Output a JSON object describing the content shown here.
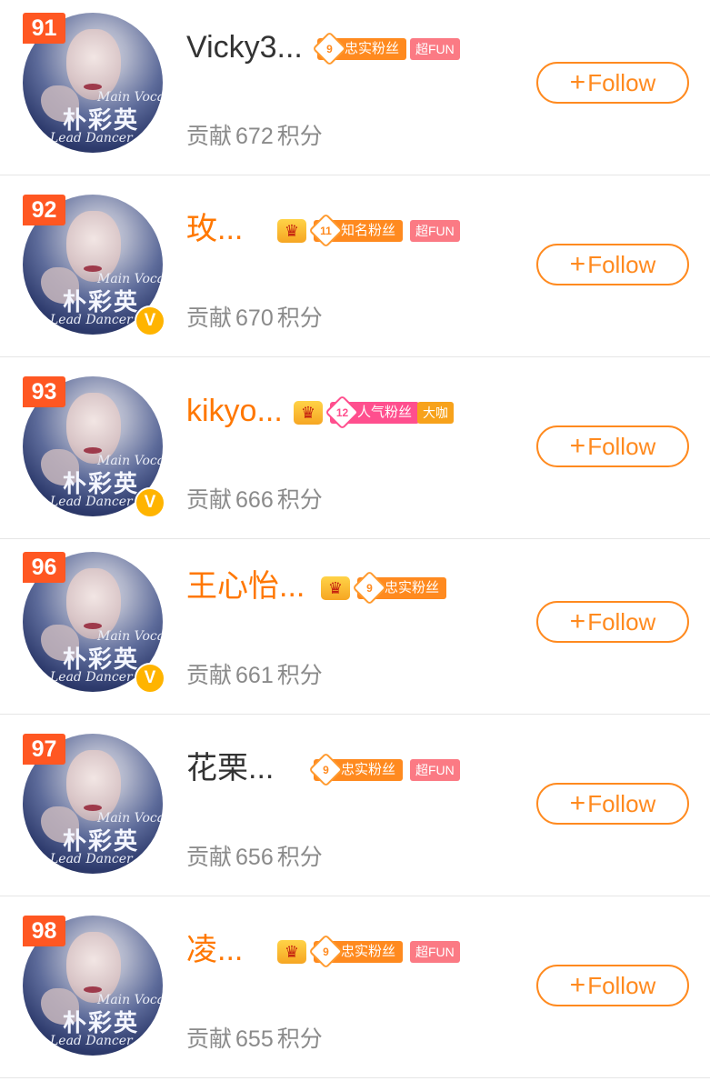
{
  "fans": [
    {
      "rank": "91",
      "name": "Vicky3...",
      "name_color": "dark",
      "crown": false,
      "verified": false,
      "fan_level": "9",
      "fan_title": "忠实粉丝",
      "fan_color": "orange",
      "tag": "超FUN",
      "tag_color": "pink",
      "score_label": "贡献",
      "score": "672",
      "score_unit": "积分",
      "follow_label": "Follow"
    },
    {
      "rank": "92",
      "name": "玫...",
      "name_color": "orange",
      "crown": true,
      "verified": true,
      "fan_level": "11",
      "fan_title": "知名粉丝",
      "fan_color": "orange",
      "tag": "超FUN",
      "tag_color": "pink",
      "score_label": "贡献",
      "score": "670",
      "score_unit": "积分",
      "follow_label": "Follow"
    },
    {
      "rank": "93",
      "name": "kikyo...",
      "name_color": "orange",
      "crown": true,
      "verified": true,
      "fan_level": "12",
      "fan_title": "人气粉丝",
      "fan_color": "pink",
      "tag": "大咖",
      "tag_color": "gold",
      "score_label": "贡献",
      "score": "666",
      "score_unit": "积分",
      "follow_label": "Follow"
    },
    {
      "rank": "96",
      "name": "王心怡...",
      "name_color": "orange",
      "crown": true,
      "verified": true,
      "fan_level": "9",
      "fan_title": "忠实粉丝",
      "fan_color": "orange",
      "tag": "",
      "tag_color": "pink",
      "score_label": "贡献",
      "score": "661",
      "score_unit": "积分",
      "follow_label": "Follow"
    },
    {
      "rank": "97",
      "name": "花栗...",
      "name_color": "dark",
      "crown": false,
      "verified": false,
      "fan_level": "9",
      "fan_title": "忠实粉丝",
      "fan_color": "orange",
      "tag": "超FUN",
      "tag_color": "pink",
      "score_label": "贡献",
      "score": "656",
      "score_unit": "积分",
      "follow_label": "Follow"
    },
    {
      "rank": "98",
      "name": "凌...",
      "name_color": "orange",
      "crown": true,
      "verified": false,
      "fan_level": "9",
      "fan_title": "忠实粉丝",
      "fan_color": "orange",
      "tag": "超FUN",
      "tag_color": "pink",
      "score_label": "贡献",
      "score": "655",
      "score_unit": "积分",
      "follow_label": "Follow"
    }
  ],
  "avatar": {
    "line1": "Main Vocal",
    "line2": "朴彩英",
    "line3": "Lead Dancer"
  },
  "verified_glyph": "V",
  "follow_plus": "+",
  "colors": {
    "accent": "#ff8a1f",
    "rank": "#ff5722",
    "name_orange": "#ff7700",
    "score": "#8a8a8a"
  },
  "icons": [
    "crown-icon",
    "verified-v-icon",
    "plus-icon"
  ]
}
